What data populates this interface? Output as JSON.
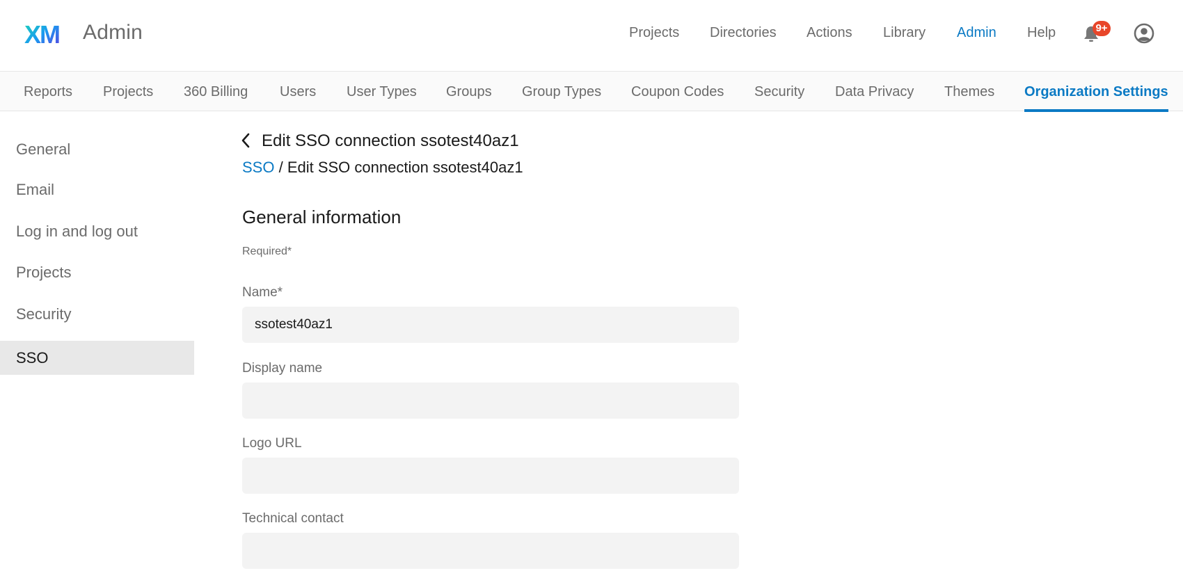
{
  "header": {
    "app_title": "Admin",
    "logo_text": "XM",
    "nav": [
      {
        "label": "Projects",
        "active": false
      },
      {
        "label": "Directories",
        "active": false
      },
      {
        "label": "Actions",
        "active": false
      },
      {
        "label": "Library",
        "active": false
      },
      {
        "label": "Admin",
        "active": true
      },
      {
        "label": "Help",
        "active": false
      }
    ],
    "notifications": {
      "icon": "bell-icon",
      "badge": "9+"
    },
    "account_icon": "user-circle-icon"
  },
  "admin_tabs": [
    {
      "label": "Reports",
      "active": false
    },
    {
      "label": "Projects",
      "active": false
    },
    {
      "label": "360 Billing",
      "active": false
    },
    {
      "label": "Users",
      "active": false
    },
    {
      "label": "User Types",
      "active": false
    },
    {
      "label": "Groups",
      "active": false
    },
    {
      "label": "Group Types",
      "active": false
    },
    {
      "label": "Coupon Codes",
      "active": false
    },
    {
      "label": "Security",
      "active": false
    },
    {
      "label": "Data Privacy",
      "active": false
    },
    {
      "label": "Themes",
      "active": false
    },
    {
      "label": "Organization Settings",
      "active": true
    }
  ],
  "sidebar": {
    "items": [
      {
        "label": "General",
        "active": false
      },
      {
        "label": "Email",
        "active": false
      },
      {
        "label": "Log in and log out",
        "active": false
      },
      {
        "label": "Projects",
        "active": false
      },
      {
        "label": "Security",
        "active": false
      },
      {
        "label": "SSO",
        "active": true
      }
    ]
  },
  "main": {
    "title": "Edit SSO connection ssotest40az1",
    "breadcrumb": {
      "link": "SSO",
      "separator": " / ",
      "current": "Edit SSO connection ssotest40az1"
    },
    "section_title": "General information",
    "required_note": "Required*",
    "fields": [
      {
        "label": "Name*",
        "value": "ssotest40az1",
        "placeholder": ""
      },
      {
        "label": "Display name",
        "value": "",
        "placeholder": ""
      },
      {
        "label": "Logo URL",
        "value": "",
        "placeholder": ""
      },
      {
        "label": "Technical contact",
        "value": "",
        "placeholder": ""
      }
    ]
  },
  "colors": {
    "accent": "#0b7ac4",
    "badge": "#e8462a",
    "input_bg": "#f3f3f3",
    "sidebar_active_bg": "#e8e8e8"
  }
}
